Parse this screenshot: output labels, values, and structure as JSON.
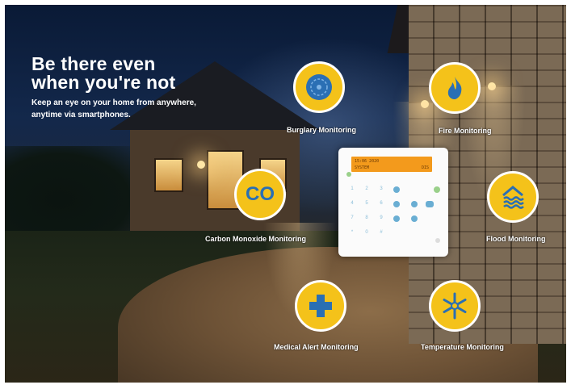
{
  "headline": {
    "line1": "Be there even",
    "line2": "when you're not",
    "sub1": "Keep an eye on your home from anywhere,",
    "sub2": "anytime via smartphones."
  },
  "features": [
    {
      "label": "Burglary Monitoring",
      "icon": "burglary-icon"
    },
    {
      "label": "Fire Monitoring",
      "icon": "fire-icon"
    },
    {
      "label": "Carbon Monoxide Monitoring",
      "icon": "co-icon",
      "icon_text": "CO"
    },
    {
      "label": "Flood Monitoring",
      "icon": "flood-icon"
    },
    {
      "label": "Medical Alert Monitoring",
      "icon": "medical-cross-icon"
    },
    {
      "label": "Temperature Monitoring",
      "icon": "snowflake-icon"
    }
  ],
  "panel": {
    "lcd_line1_left": "15:06 2020",
    "lcd_line2_left": "SYSTEM",
    "lcd_line2_right": "DIS",
    "keys": [
      "1",
      "2",
      "3",
      "4",
      "5",
      "6",
      "7",
      "8",
      "9",
      "*",
      "0",
      "#"
    ]
  },
  "colors": {
    "accent_yellow": "#f4c21a",
    "icon_blue": "#2a6fb4",
    "lcd_orange": "#f39a1c"
  }
}
